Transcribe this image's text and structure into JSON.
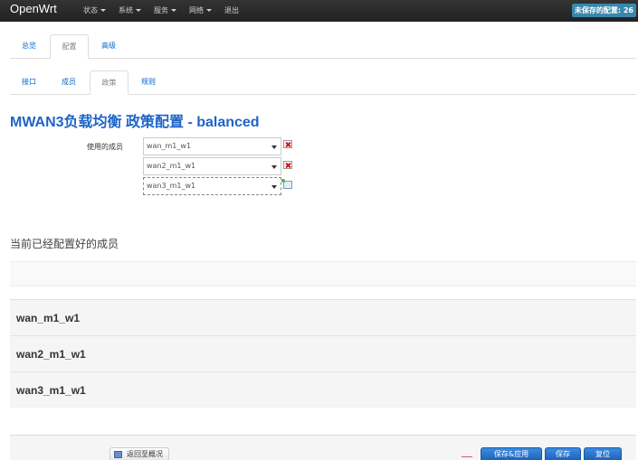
{
  "navbar": {
    "brand": "OpenWrt",
    "menu": [
      "状态",
      "系统",
      "服务",
      "网络",
      "退出"
    ],
    "unsaved": "未保存的配置: 26"
  },
  "tabs_main": {
    "items": [
      "总览",
      "配置",
      "高级"
    ],
    "active": "配置"
  },
  "tabs_sub": {
    "items": [
      "接口",
      "成员",
      "政策",
      "规则"
    ],
    "active": "政策"
  },
  "page_title": "MWAN3负载均衡 政策配置 - balanced",
  "form": {
    "label": "使用的成员",
    "selects": [
      "wan_m1_w1",
      "wan2_m1_w1",
      "wan3_m1_w1"
    ]
  },
  "members_section": {
    "title": "当前已经配置好的成员",
    "members": [
      "wan_m1_w1",
      "wan2_m1_w1",
      "wan3_m1_w1"
    ]
  },
  "footer": {
    "back_label": "返回至概况",
    "save_apply_label": "保存&应用",
    "save_label": "保存",
    "reset_label": "复位"
  },
  "colors": {
    "navbar": "#222222",
    "link": "#0069d6",
    "title": "#1e64c8",
    "primary_button": "#2a74d0",
    "badge": "#3a87ad"
  }
}
